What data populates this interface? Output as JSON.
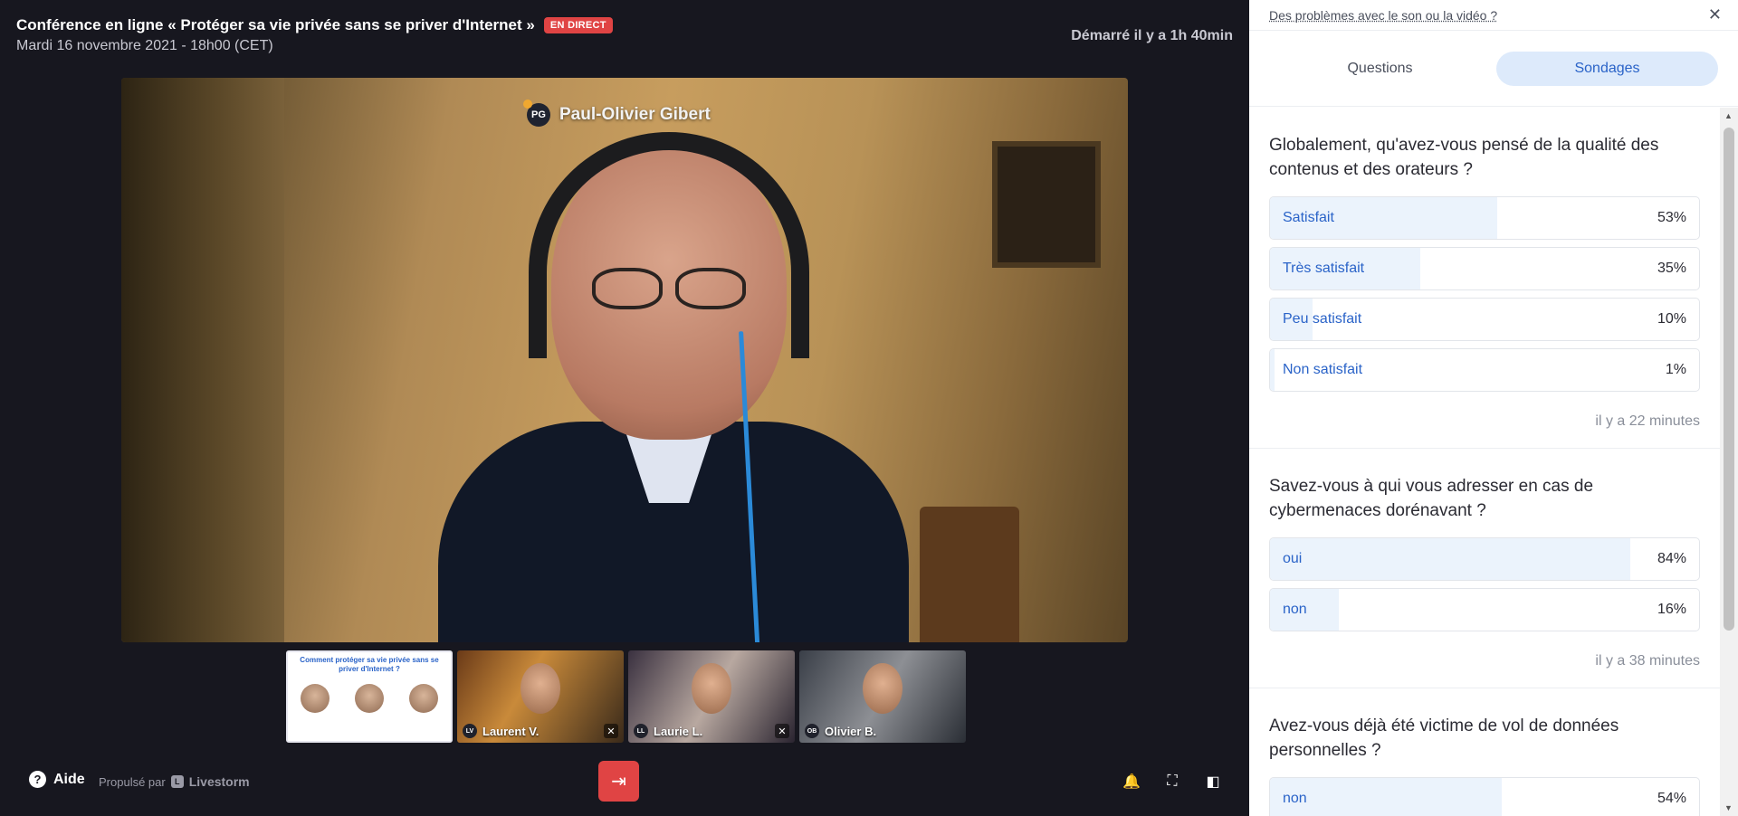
{
  "header": {
    "title": "Conférence en ligne « Protéger sa vie privée sans se priver d'Internet »",
    "live_badge": "EN DIRECT",
    "subtitle": "Mardi 16 novembre 2021 - 18h00 (CET)",
    "started": "Démarré il y a 1h 40min"
  },
  "main_speaker": {
    "initials": "PG",
    "name": "Paul-Olivier Gibert"
  },
  "thumbnails": [
    {
      "type": "slide",
      "title": "Comment protéger sa vie privée sans se priver d'Internet ?"
    },
    {
      "type": "video",
      "initials": "LV",
      "name": "Laurent V.",
      "muted": true
    },
    {
      "type": "video",
      "initials": "LL",
      "name": "Laurie L.",
      "muted": true
    },
    {
      "type": "video",
      "initials": "OB",
      "name": "Olivier B.",
      "muted": false
    }
  ],
  "footer": {
    "help_label": "Aide",
    "powered_by": "Propulsé par",
    "brand": "Livestorm",
    "leave_icon": "exit-icon",
    "controls": [
      "bell-icon",
      "fullscreen-icon",
      "sidebar-toggle-icon"
    ]
  },
  "panel": {
    "issue_link": "Des problèmes avec le son ou la vidéo ?",
    "tabs": [
      {
        "label": "Questions",
        "active": false
      },
      {
        "label": "Sondages",
        "active": true
      }
    ],
    "polls": [
      {
        "question": "Globalement, qu'avez-vous pensé de la qualité des contenus et des orateurs ?",
        "options": [
          {
            "label": "Satisfait",
            "pct": "53%",
            "value": 53
          },
          {
            "label": "Très satisfait",
            "pct": "35%",
            "value": 35
          },
          {
            "label": "Peu satisfait",
            "pct": "10%",
            "value": 10
          },
          {
            "label": "Non satisfait",
            "pct": "1%",
            "value": 1
          }
        ],
        "time": "il y a 22 minutes"
      },
      {
        "question": "Savez-vous à qui vous adresser en cas de cybermenaces dorénavant ?",
        "options": [
          {
            "label": "oui",
            "pct": "84%",
            "value": 84
          },
          {
            "label": "non",
            "pct": "16%",
            "value": 16
          }
        ],
        "time": "il y a 38 minutes"
      },
      {
        "question": "Avez-vous déjà été victime de vol de données personnelles ?",
        "options": [
          {
            "label": "non",
            "pct": "54%",
            "value": 54
          }
        ],
        "time": ""
      }
    ]
  },
  "colors": {
    "accent": "#2a63c8",
    "live": "#e04444",
    "stage_bg": "#17171f",
    "fill": "#ebf3fc"
  }
}
